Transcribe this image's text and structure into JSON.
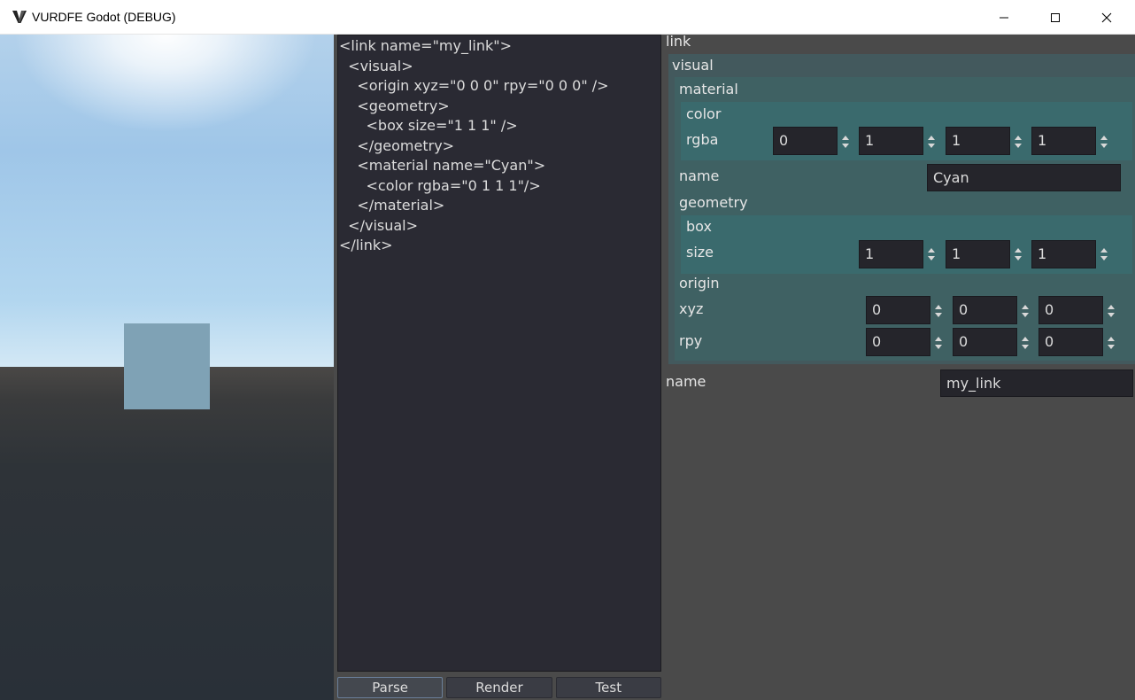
{
  "window": {
    "title": "VURDFE Godot (DEBUG)",
    "app_icon_glyph": "V"
  },
  "editor": {
    "code_lines": [
      "<link name=\"my_link\">",
      "  <visual>",
      "    <origin xyz=\"0 0 0\" rpy=\"0 0 0\" />",
      "    <geometry>",
      "      <box size=\"1 1 1\" />",
      "    </geometry>",
      "    <material name=\"Cyan\">",
      "      <color rgba=\"0 1 1 1\"/>",
      "    </material>",
      "  </visual>",
      "</link>"
    ],
    "buttons": {
      "parse": "Parse",
      "render": "Render",
      "test": "Test"
    }
  },
  "inspector": {
    "link_label": "link",
    "visual_label": "visual",
    "material_label": "material",
    "color_label": "color",
    "rgba_label": "rgba",
    "rgba_values": [
      "0",
      "1",
      "1",
      "1"
    ],
    "material_name_label": "name",
    "material_name_value": "Cyan",
    "geometry_label": "geometry",
    "box_label": "box",
    "size_label": "size",
    "size_values": [
      "1",
      "1",
      "1"
    ],
    "origin_label": "origin",
    "xyz_label": "xyz",
    "xyz_values": [
      "0",
      "0",
      "0"
    ],
    "rpy_label": "rpy",
    "rpy_values": [
      "0",
      "0",
      "0"
    ],
    "link_name_label": "name",
    "link_name_value": "my_link"
  },
  "viewport": {
    "cube_color": "#7fa2b5",
    "sky_color": "#9fc6e8",
    "ground_color": "#293038"
  }
}
